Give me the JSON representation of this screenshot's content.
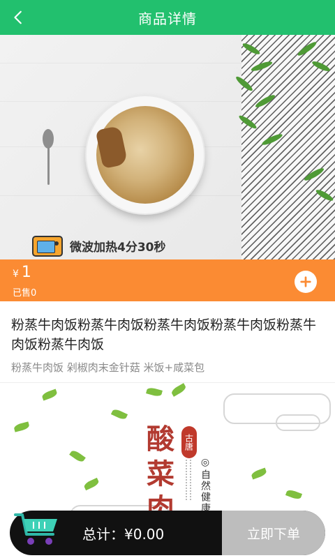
{
  "header": {
    "title": "商品详情",
    "back_icon": "chevron-left-icon"
  },
  "hero": {
    "heating_text": "微波加热4分30秒",
    "microwave_icon": "microwave-icon"
  },
  "price_bar": {
    "currency": "¥",
    "price": "1",
    "sold": "已售0",
    "add_icon": "plus-circle-icon"
  },
  "product": {
    "name": "粉蒸牛肉饭粉蒸牛肉饭粉蒸牛肉饭粉蒸牛肉饭粉蒸牛肉饭粉蒸牛肉饭",
    "description": "粉蒸牛肉饭 剁椒肉末金针菇 米饭+咸菜包"
  },
  "detail_image": {
    "title_chars": [
      "酸",
      "菜",
      "肉"
    ],
    "seal_text": "古唐",
    "vertical_text": "◎自然健康◎"
  },
  "bottom_bar": {
    "total_label": "总计：¥0.00",
    "order_button": "立即下单",
    "cart_icon": "shopping-cart-icon"
  },
  "colors": {
    "header": "#22c06e",
    "price_bar": "#fb8b33",
    "bottom_bar": "#111111",
    "order_button": "#bdbdbd"
  }
}
